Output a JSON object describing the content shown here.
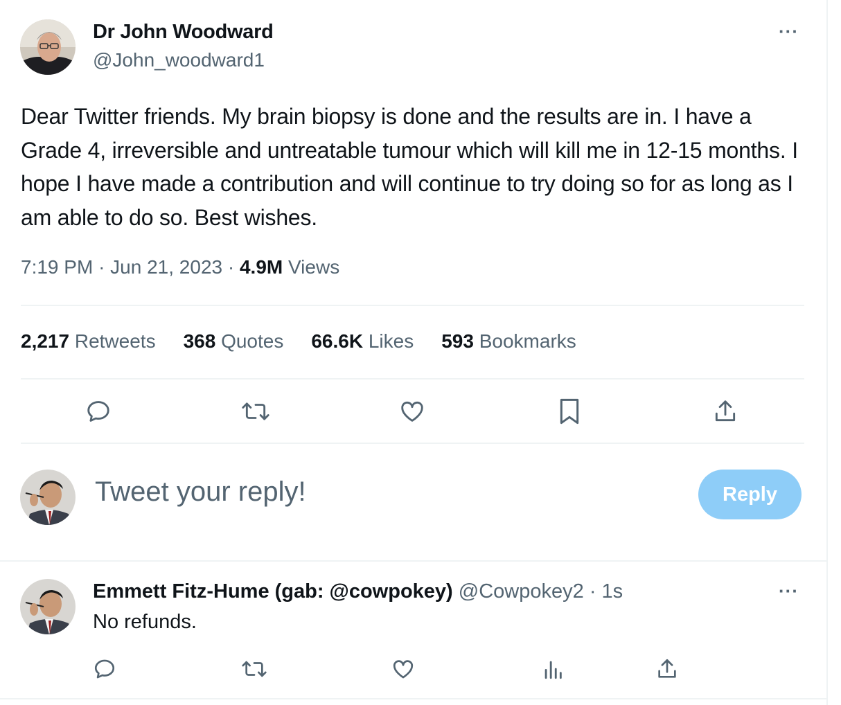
{
  "tweet": {
    "author_name": "Dr John Woodward",
    "author_handle": "@John_woodward1",
    "more_label": "···",
    "text": "Dear Twitter friends. My brain biopsy is done and the results are in. I have a Grade 4, irreversible and untreatable tumour which will kill me in 12-15 months. I hope I have made a contribution and will continue to try doing so for as long as I am able to do so. Best wishes.",
    "time": "7:19 PM",
    "date": "Jun 21, 2023",
    "views_count": "4.9M",
    "views_label": "Views",
    "separator": "·",
    "stats": {
      "retweets_count": "2,217",
      "retweets_label": "Retweets",
      "quotes_count": "368",
      "quotes_label": "Quotes",
      "likes_count": "66.6K",
      "likes_label": "Likes",
      "bookmarks_count": "593",
      "bookmarks_label": "Bookmarks"
    }
  },
  "composer": {
    "placeholder": "Tweet your reply!",
    "button_label": "Reply"
  },
  "reply": {
    "author_name": "Emmett Fitz-Hume (gab: @cowpokey)",
    "author_handle": "@Cowpokey2",
    "separator": "·",
    "time": "1s",
    "text": "No refunds.",
    "more_label": "···"
  },
  "icons": {
    "action_icons": [
      "reply-icon",
      "retweet-icon",
      "like-icon",
      "bookmark-icon",
      "share-icon"
    ],
    "reply_action_icons": [
      "reply-icon",
      "retweet-icon",
      "like-icon",
      "views-icon",
      "share-icon"
    ]
  },
  "colors": {
    "text": "#0f1419",
    "secondary": "#536471",
    "divider": "#eff3f4",
    "reply_button": "#8ecdf8"
  }
}
